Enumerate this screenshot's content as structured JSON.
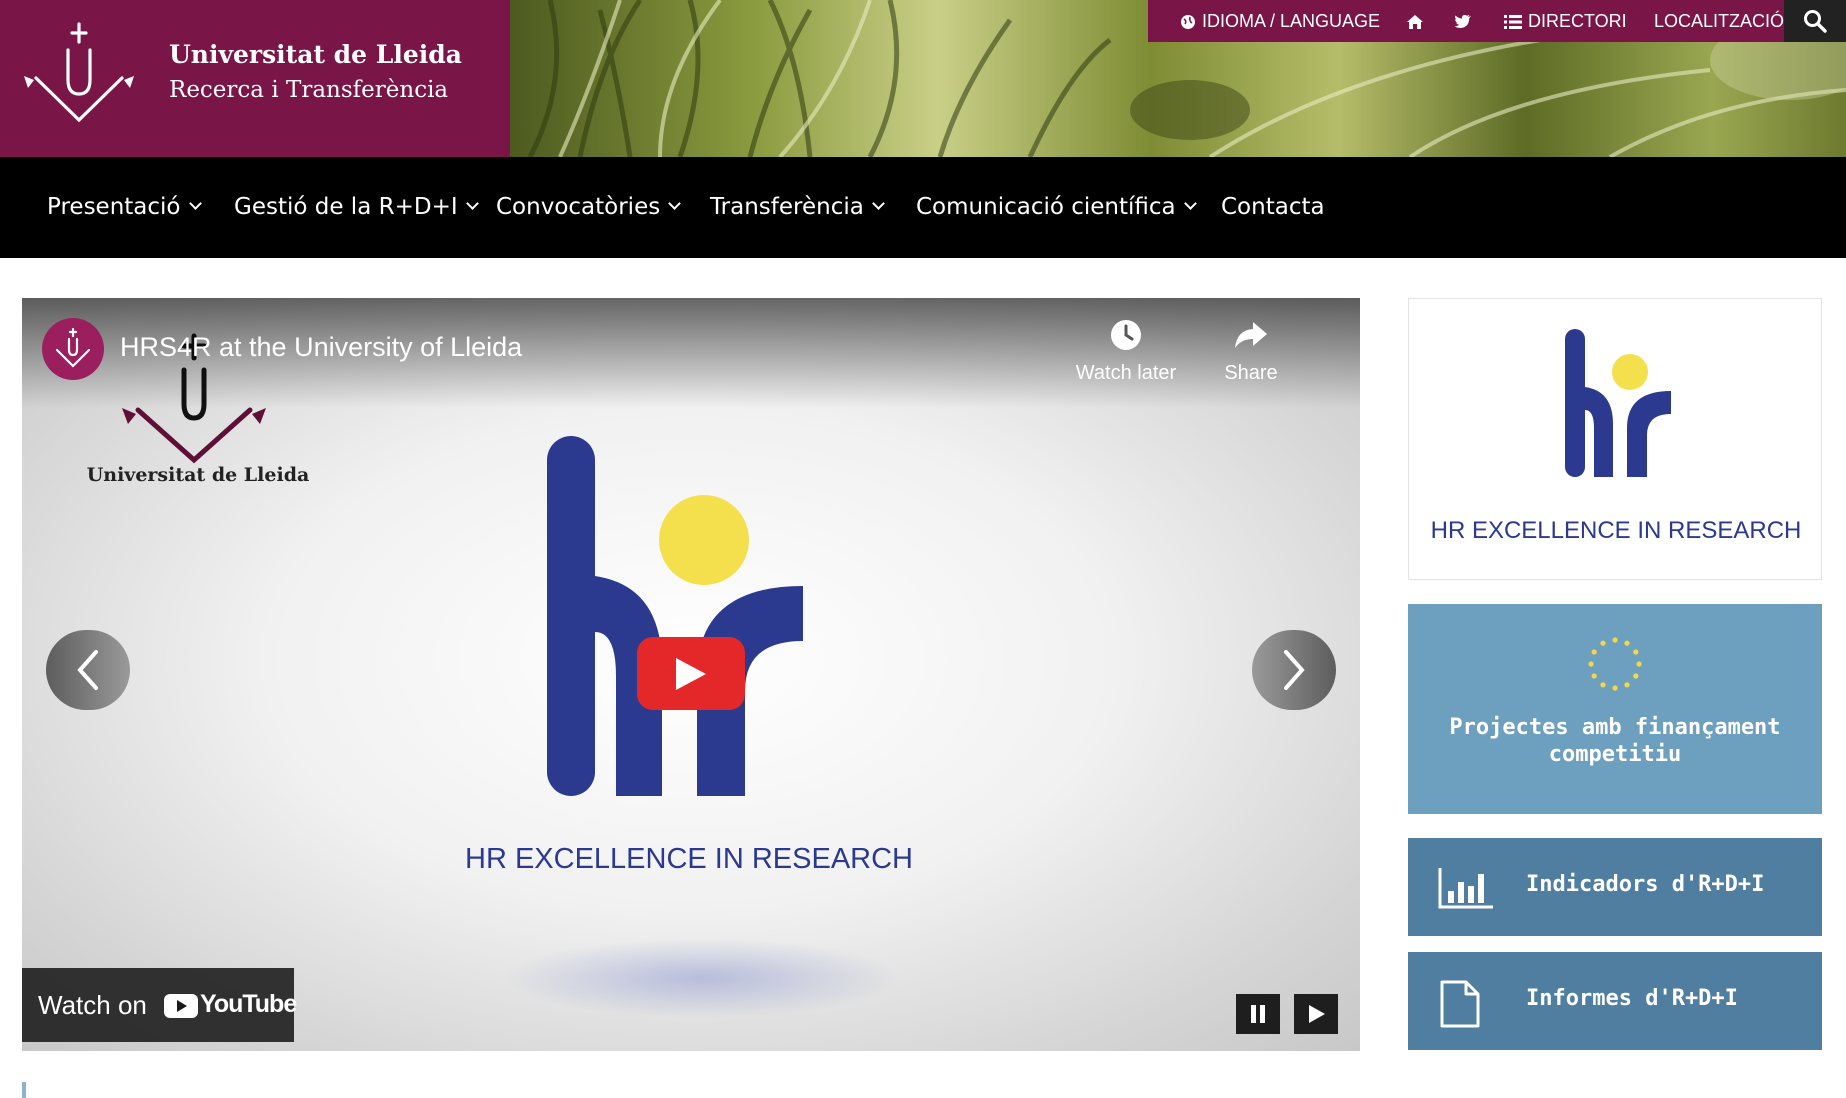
{
  "site": {
    "title": "Universitat de Lleida",
    "subtitle": "Recerca i Transferència"
  },
  "topbar": {
    "language_label": "IDIOMA / LANGUAGE",
    "home_icon": "home-icon",
    "twitter_icon": "twitter-icon",
    "directory_label": "DIRECTORI",
    "location_label": "LOCALITZACIÓ",
    "search_icon": "search-icon"
  },
  "nav": {
    "items": [
      {
        "label": "Presentació",
        "has_dropdown": true
      },
      {
        "label": "Gestió de la R+D+I",
        "has_dropdown": true
      },
      {
        "label": "Convocatòries",
        "has_dropdown": true
      },
      {
        "label": "Transferència",
        "has_dropdown": true
      },
      {
        "label": "Comunicació científica",
        "has_dropdown": true
      },
      {
        "label": "Contacta",
        "has_dropdown": false
      }
    ]
  },
  "video": {
    "title": "HRS4R at the University of Lleida",
    "watch_later_label": "Watch later",
    "share_label": "Share",
    "overlay_university_name": "Universitat de Lleida",
    "hr_caption": "HR EXCELLENCE IN RESEARCH",
    "watch_on_label": "Watch on",
    "youtube_wordmark": "YouTube"
  },
  "sidebar": {
    "hr_card_caption": "HR EXCELLENCE IN RESEARCH",
    "projects_label": "Projectes amb finançament competitiu",
    "indicators_label": "Indicadors d'R+D+I",
    "reports_label": "Informes d'R+D+I"
  },
  "colors": {
    "brand_burgundy": "#7a1548",
    "nav_black": "#000000",
    "hr_navy": "#2b3a8e",
    "hr_yellow": "#f4e04d",
    "youtube_red": "#e4282a",
    "projects_blue": "#6d9fbf",
    "tile_blue": "#4f7ea0"
  }
}
